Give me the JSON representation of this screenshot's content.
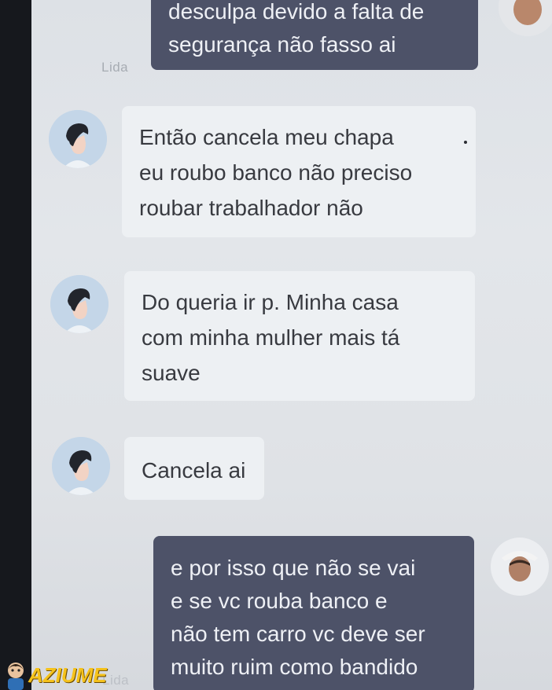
{
  "messages": [
    {
      "from": "me",
      "lines": [
        "desculpa devido a falta de",
        "segurança não fasso ai"
      ],
      "status": "Lida"
    },
    {
      "from": "driver",
      "lines": [
        "Então cancela meu chapa",
        "eu roubo banco não preciso",
        "roubar trabalhador não"
      ]
    },
    {
      "from": "driver",
      "lines": [
        "Do queria ir p. Minha casa",
        "com minha mulher mais tá",
        "suave"
      ]
    },
    {
      "from": "driver",
      "lines": [
        "Cancela ai"
      ]
    },
    {
      "from": "me",
      "lines": [
        "e por isso que não se vai",
        "e se vc rouba banco e",
        "não tem carro vc deve ser",
        "muito ruim como bandido"
      ],
      "status": "Lida"
    }
  ],
  "watermark": {
    "text": "AZIUME"
  },
  "colors": {
    "outgoing_bubble": "#4d5268",
    "incoming_bubble": "#edf0f3",
    "background": "#e0e3e7",
    "watermark": "#f5c21b"
  },
  "icons": {
    "contact_avatar": "person-avatar-icon",
    "user_avatar": "user-photo-avatar"
  }
}
